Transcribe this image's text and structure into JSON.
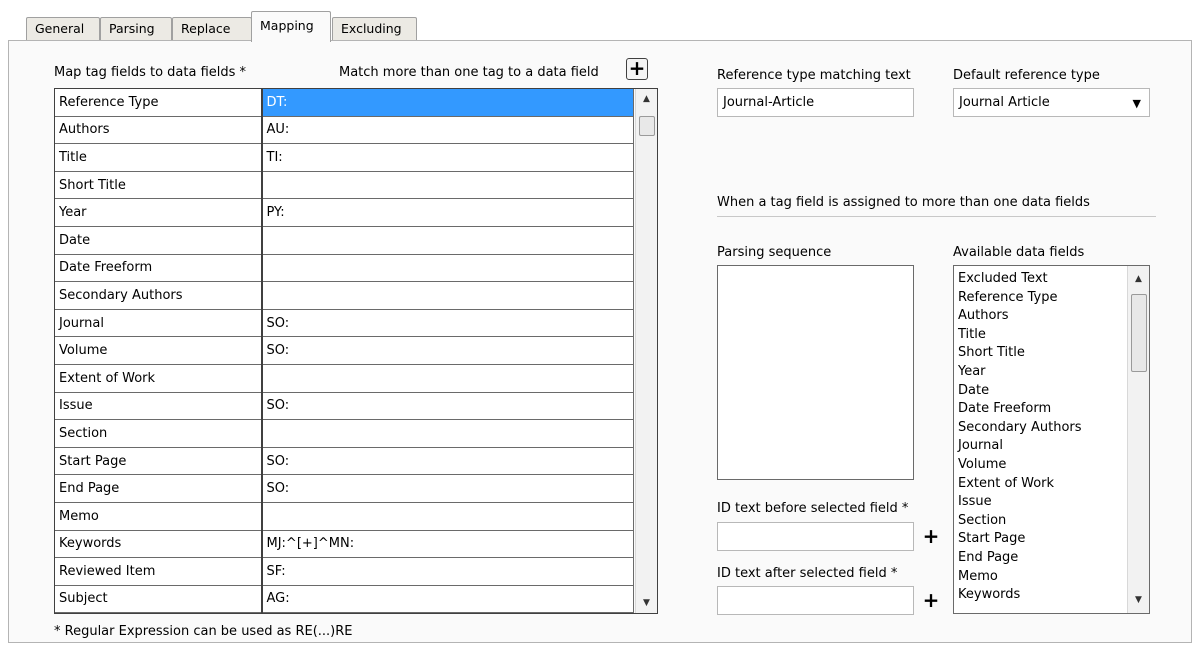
{
  "tabs": [
    "General",
    "Parsing",
    "Replace",
    "Mapping",
    "Excluding"
  ],
  "active_tab": "Mapping",
  "mapping": {
    "title": "Map tag fields to data fields *",
    "match_label": "Match more than one tag to a data field",
    "add_button": "+",
    "rows": [
      {
        "field": "Reference Type",
        "tag": "DT:"
      },
      {
        "field": "Authors",
        "tag": "AU:"
      },
      {
        "field": "Title",
        "tag": "TI:"
      },
      {
        "field": "Short Title",
        "tag": ""
      },
      {
        "field": "Year",
        "tag": "PY:"
      },
      {
        "field": "Date",
        "tag": ""
      },
      {
        "field": "Date Freeform",
        "tag": ""
      },
      {
        "field": "Secondary Authors",
        "tag": ""
      },
      {
        "field": "Journal",
        "tag": "SO:"
      },
      {
        "field": "Volume",
        "tag": "SO:"
      },
      {
        "field": "Extent of Work",
        "tag": ""
      },
      {
        "field": "Issue",
        "tag": "SO:"
      },
      {
        "field": "Section",
        "tag": ""
      },
      {
        "field": "Start Page",
        "tag": "SO:"
      },
      {
        "field": "End Page",
        "tag": "SO:"
      },
      {
        "field": "Memo",
        "tag": ""
      },
      {
        "field": "Keywords",
        "tag": "MJ:^[+]^MN:"
      },
      {
        "field": "Reviewed Item",
        "tag": "SF:"
      },
      {
        "field": "Subject",
        "tag": "AG:"
      }
    ],
    "footnote": "* Regular Expression can be used as RE(...)RE"
  },
  "reference": {
    "matching_label": "Reference type matching text",
    "matching_value": "Journal-Article",
    "default_label": "Default reference type",
    "default_value": "Journal Article"
  },
  "multi": {
    "heading": "When a tag field is assigned to more than one data fields",
    "parsing_label": "Parsing sequence",
    "available_label": "Available data fields",
    "available_fields": [
      "Excluded Text",
      "Reference Type",
      "Authors",
      "Title",
      "Short Title",
      "Year",
      "Date",
      "Date Freeform",
      "Secondary Authors",
      "Journal",
      "Volume",
      "Extent of Work",
      "Issue",
      "Section",
      "Start Page",
      "End Page",
      "Memo",
      "Keywords"
    ],
    "before_label": "ID text before selected field *",
    "before_value": "",
    "after_label": "ID text after selected field *",
    "after_value": "",
    "add_before": "+",
    "add_after": "+"
  },
  "icons": {
    "scroll_up": "triangle-up-icon",
    "scroll_down": "triangle-down-icon",
    "dropdown": "chevron-down-icon"
  }
}
